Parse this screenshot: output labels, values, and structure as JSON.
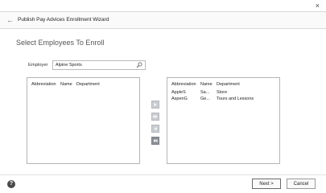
{
  "window": {
    "close_glyph": "×",
    "back_glyph": "←",
    "title": "Publish Pay Advices Enrollment Wizard"
  },
  "page": {
    "heading": "Select Employees To Enroll"
  },
  "employer": {
    "label": "Employer",
    "value": "Alpine Sports"
  },
  "available_list": {
    "columns": [
      "Abbreviation",
      "Name",
      "Department"
    ],
    "rows": []
  },
  "selected_list": {
    "columns": [
      "Abbreviation",
      "Name",
      "Department"
    ],
    "rows": [
      {
        "abbreviation": "AppleS",
        "name": "Sa...",
        "department": "Store"
      },
      {
        "abbreviation": "AspenG",
        "name": "Ge...",
        "department": "Tours and Lessons"
      }
    ]
  },
  "transfer_buttons": [
    {
      "icon": "move-right-icon"
    },
    {
      "icon": "move-all-right-icon"
    },
    {
      "icon": "move-left-icon"
    },
    {
      "icon": "move-all-left-icon"
    }
  ],
  "footer": {
    "help_glyph": "?",
    "next_label": "Next >",
    "cancel_label": "Cancel"
  }
}
